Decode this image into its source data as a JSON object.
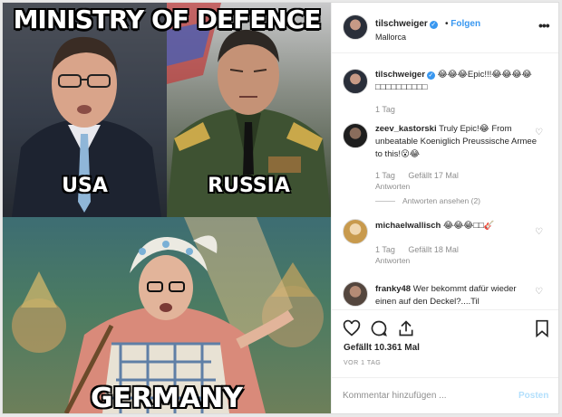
{
  "meme": {
    "title": "MINISTRY OF DEFENCE",
    "label_usa": "USA",
    "label_russia": "RUSSIA",
    "label_germany": "GERMANY"
  },
  "header": {
    "username": "tilschweiger",
    "follow_label": "Folgen",
    "follow_separator": "•",
    "location": "Mallorca",
    "more_icon": "more-horizontal-icon"
  },
  "caption": {
    "username": "tilschweiger",
    "text": "😂😂😂Epic!!!😂😂😂😂□□□□□□□□□□",
    "time": "1 Tag"
  },
  "comments": [
    {
      "username": "zeev_kastorski",
      "text": "Truly Epic!😂 From unbeatable Koeniglich Preussische Armee to this!😮😂",
      "time": "1 Tag",
      "likes": "Gefällt 17 Mal",
      "reply": "Antworten",
      "view_replies": "Antworten ansehen (2)"
    },
    {
      "username": "michaelwallisch",
      "text": "😂😂😂□□🎸",
      "time": "1 Tag",
      "likes": "Gefällt 18 Mal",
      "reply": "Antworten"
    },
    {
      "username": "franky48",
      "text": "Wer bekommt dafür wieder einen auf den Deckel?....Til"
    }
  ],
  "actions": {
    "like_icon": "heart-icon",
    "comment_icon": "comment-icon",
    "share_icon": "share-icon",
    "save_icon": "bookmark-icon"
  },
  "likes": "Gefällt 10.361 Mal",
  "date": "VOR 1 TAG",
  "comment_input": {
    "placeholder": "Kommentar hinzufügen ...",
    "post_label": "Posten"
  },
  "colors": {
    "accent": "#3897f0",
    "text": "#262626",
    "muted": "#8e8e8e",
    "post_disabled": "#b2dffc"
  }
}
